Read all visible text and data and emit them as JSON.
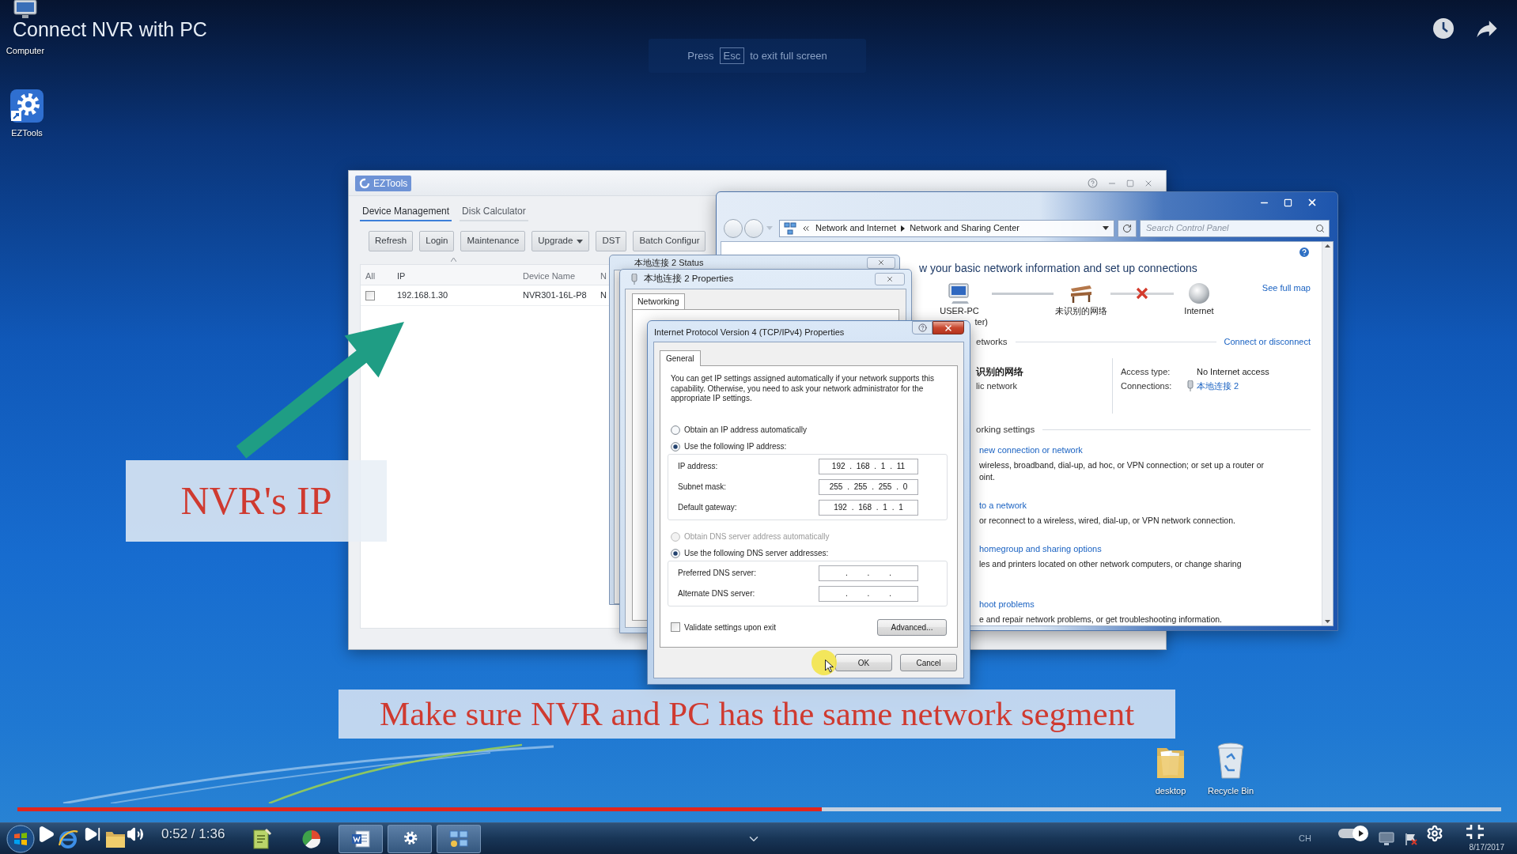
{
  "player": {
    "title": "Connect NVR with PC",
    "fullscreen_hint": {
      "before": "Press",
      "key": "Esc",
      "after": "to exit full screen"
    },
    "progress": {
      "level": 0.542
    },
    "time": "0:52 / 1:36",
    "autoplay": {
      "on": true
    }
  },
  "desktop_icons_top": [
    {
      "kind": "computer",
      "label": "Computer"
    },
    {
      "kind": "app",
      "label": "EZTools"
    }
  ],
  "eztools": {
    "title": "EZTools",
    "tabs": [
      {
        "label": "Device Management",
        "selected": true
      },
      {
        "label": "Disk Calculator",
        "selected": false
      }
    ],
    "toolbar": [
      {
        "kind": "button",
        "label": "Refresh"
      },
      {
        "kind": "button",
        "label": "Login"
      },
      {
        "kind": "button",
        "label": "Maintenance"
      },
      {
        "kind": "dropdown",
        "label": "Upgrade"
      },
      {
        "kind": "button",
        "label": "DST"
      },
      {
        "kind": "button",
        "label": "Batch Configur"
      }
    ],
    "table": {
      "columns": [
        {
          "label": "All",
          "sorted": false
        },
        {
          "label": "IP",
          "sorted": true
        },
        {
          "label": "Device Name",
          "sorted": false
        },
        {
          "label": "N",
          "sorted": false
        }
      ],
      "rows": [
        {
          "checked": false,
          "cells": [
            "",
            "192.168.1.30",
            "NVR301-16L-P8",
            "N"
          ]
        }
      ]
    }
  },
  "status_dialog": {
    "title": "本地连接 2 Status"
  },
  "properties_dialog": {
    "title": "本地连接 2 Properties",
    "tabs": [
      {
        "label": "Networking",
        "selected": true
      }
    ]
  },
  "network_center": {
    "breadcrumb": [
      "Network and Internet",
      "Network and Sharing Center"
    ],
    "search": {
      "placeholder": "Search Control Panel"
    },
    "heading": "w your basic network information and set up connections",
    "map": {
      "nodes": [
        {
          "kind": "computer",
          "label": "USER-PC",
          "sublabel": "ter)"
        },
        {
          "kind": "network",
          "label": "未识别的网络"
        },
        {
          "kind": "internet",
          "label": "Internet"
        }
      ],
      "links": [
        {
          "connected": true
        },
        {
          "connected": false
        }
      ],
      "link": "See full map"
    },
    "active_networks": {
      "label": "etworks",
      "link": "Connect or disconnect",
      "name": "识别的网络",
      "category": "lic network",
      "details": [
        {
          "kind": "text",
          "label": "Access type:",
          "value": "No Internet access"
        },
        {
          "kind": "link",
          "label": "Connections:",
          "value": "本地连接 2"
        }
      ]
    },
    "change_settings": {
      "label": "orking settings",
      "tasks": [
        {
          "link": "new connection or network",
          "lines": [
            "wireless, broadband, dial-up, ad hoc, or VPN connection; or set up a router or",
            "oint."
          ]
        },
        {
          "link": "to a network",
          "lines": [
            "or reconnect to a wireless, wired, dial-up, or VPN network connection."
          ]
        },
        {
          "link": "homegroup and sharing options",
          "lines": [
            "les and printers located on other network computers, or change sharing"
          ]
        },
        {
          "link": "hoot problems",
          "lines": [
            "e and repair network problems, or get troubleshooting information."
          ]
        }
      ]
    }
  },
  "ipv4_dialog": {
    "title": "Internet Protocol Version 4 (TCP/IPv4) Properties",
    "tabs": [
      {
        "label": "General",
        "selected": true
      }
    ],
    "description": "You can get IP settings assigned automatically if your network supports this capability. Otherwise, you need to ask your network administrator for the appropriate IP settings.",
    "ip_mode": [
      {
        "label": "Obtain an IP address automatically",
        "selected": false,
        "disabled": false
      },
      {
        "label": "Use the following IP address:",
        "selected": true,
        "disabled": false
      }
    ],
    "ip_fields": [
      {
        "label": "IP address:",
        "value": "192 . 168 . 1 . 11"
      },
      {
        "label": "Subnet mask:",
        "value": "255 . 255 . 255 . 0"
      },
      {
        "label": "Default gateway:",
        "value": "192 . 168 . 1 . 1"
      }
    ],
    "dns_mode": [
      {
        "label": "Obtain DNS server address automatically",
        "selected": false,
        "disabled": true
      },
      {
        "label": "Use the following DNS server addresses:",
        "selected": true,
        "disabled": false
      }
    ],
    "dns_fields": [
      {
        "label": "Preferred DNS server:",
        "value": ". . ."
      },
      {
        "label": "Alternate DNS server:",
        "value": ". . ."
      }
    ],
    "validate": {
      "label": "Validate settings upon exit",
      "checked": false
    },
    "advanced": "Advanced...",
    "buttons": [
      "OK",
      "Cancel"
    ]
  },
  "annotations": {
    "callout": "NVR's IP",
    "caption": "Make sure NVR and PC has the same network segment"
  },
  "desktop_icons_bottom": [
    {
      "kind": "folder",
      "label": "desktop"
    },
    {
      "kind": "recycle_bin",
      "label": "Recycle Bin"
    }
  ],
  "taskbar": {
    "apps": [
      {
        "kind": "browser",
        "running": false
      },
      {
        "kind": "folder",
        "running": false
      },
      {
        "kind": "notepad",
        "running": false
      },
      {
        "kind": "pie",
        "running": false
      },
      {
        "kind": "word",
        "running": true
      },
      {
        "kind": "gear",
        "running": true
      },
      {
        "kind": "network",
        "running": true
      }
    ],
    "language": "CH",
    "date": "8/17/2017"
  }
}
